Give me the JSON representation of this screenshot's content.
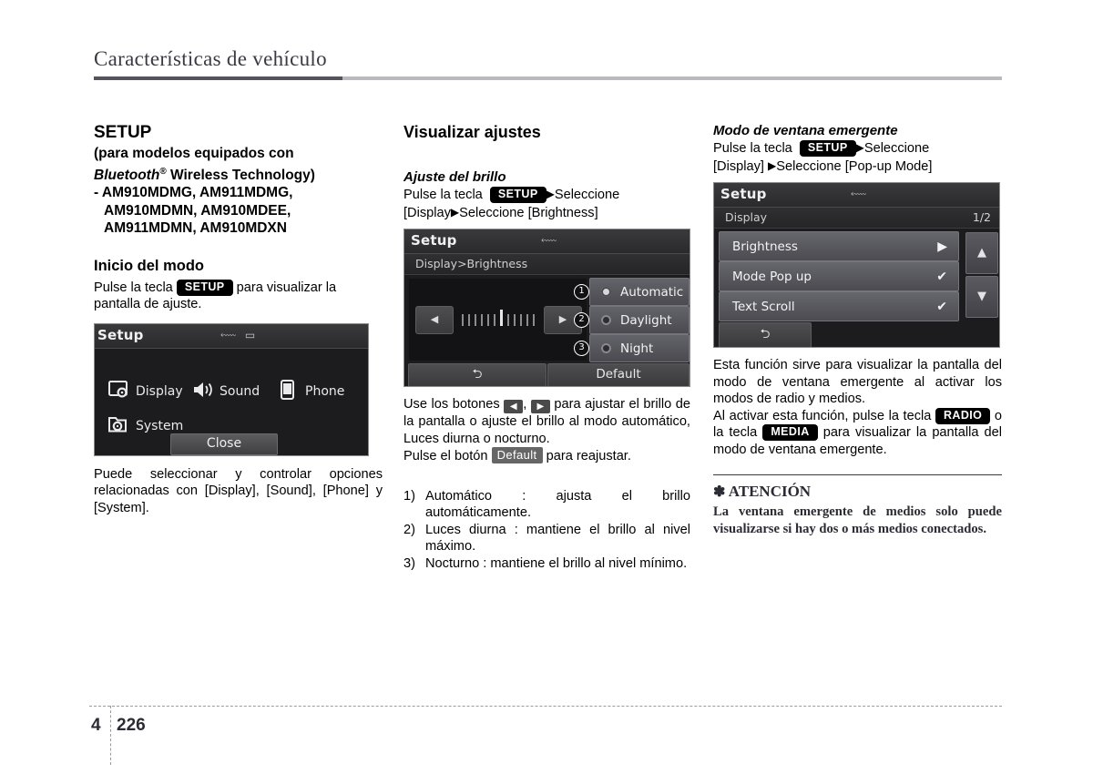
{
  "header": {
    "chapter_title": "Características de vehículo"
  },
  "footer": {
    "chapter_number": "4",
    "page_number": "226"
  },
  "left_column": {
    "heading": "SETUP",
    "subheading_line1": "(para modelos equipados con",
    "subheading_bluetooth": "Bluetooth",
    "subheading_reg": "®",
    "subheading_line2_rest": " Wireless Technology)",
    "model_line1": "- AM910MDMG, AM911MDMG,",
    "model_line2": "AM910MDMN, AM910MDEE,",
    "model_line3": "AM911MDMN, AM910MDXN",
    "section_heading": "Inicio del modo",
    "para_before_key": "Pulse la tecla",
    "key_setup": "SETUP",
    "para_after_key": "para visualizar la pantalla de ajuste.",
    "caption": "Puede seleccionar y controlar opciones relacionadas con [Display], [Sound], [Phone] y [System].",
    "device": {
      "title": "Setup",
      "icons": "⬳ ▭",
      "tiles": [
        {
          "label": "Display",
          "icon": "display-gear-icon"
        },
        {
          "label": "Sound",
          "icon": "speaker-icon"
        },
        {
          "label": "Phone",
          "icon": "phone-icon"
        },
        {
          "label": "System",
          "icon": "folder-gear-icon"
        }
      ],
      "close_label": "Close"
    }
  },
  "middle_column": {
    "heading": "Visualizar ajustes",
    "sub_italic": "Ajuste del brillo",
    "path_before_key": "Pulse  la  tecla",
    "key_setup": "SETUP",
    "path_after_key": "Seleccione",
    "path_line2a": "[Display",
    "path_line2b": "Seleccione [Brightness]",
    "device": {
      "title": "Setup",
      "icons": "⬳",
      "breadcrumb": "Display>Brightness",
      "options": [
        {
          "num": "1",
          "label": "Automatic",
          "selected": true
        },
        {
          "num": "2",
          "label": "Daylight",
          "selected": false
        },
        {
          "num": "3",
          "label": "Night",
          "selected": false
        }
      ],
      "back_icon": "back-arrow-icon",
      "default_label": "Default"
    },
    "para_use_1": "Use los botones",
    "para_use_sep": ",",
    "para_use_2": "para ajustar el brillo de la pantalla o ajuste el brillo al modo automático, Luces diurna o nocturno.",
    "para_default_1": "Pulse el botón",
    "key_default": "Default",
    "para_default_2": "para reajustar.",
    "numbered_items": [
      {
        "num": "1)",
        "text": "Automático  :  ajusta  el  brillo automáticamente."
      },
      {
        "num": "2)",
        "text": "Luces diurna : mantiene el brillo al nivel máximo."
      },
      {
        "num": "3)",
        "text": "Nocturno : mantiene el brillo al nivel mínimo."
      }
    ]
  },
  "right_column": {
    "sub_italic": "Modo de ventana emergente",
    "path_before_key": "Pulse   la   tecla",
    "key_setup": "SETUP",
    "path_after_key": "Seleccione",
    "path_line2": "[Display]",
    "path_line2b": "Seleccione [Pop-up Mode]",
    "device": {
      "title": "Setup",
      "icons": "⬳",
      "breadcrumb": "Display",
      "page_indicator": "1/2",
      "rows": [
        {
          "label": "Brightness",
          "mark": "▶"
        },
        {
          "label": "Mode Pop up",
          "mark": "✔"
        },
        {
          "label": "Text Scroll",
          "mark": "✔"
        }
      ],
      "scroll_up": "▲",
      "scroll_down": "▼",
      "back_icon": "back-arrow-icon"
    },
    "para1": "Esta función sirve para visualizar la pantalla del modo de ventana emergente al activar los modos de radio y medios.",
    "para2_a": "Al activar esta función, pulse la tecla",
    "key_radio": "RADIO",
    "para2_b": "o  la  tecla",
    "key_media": "MEDIA",
    "para2_c": "para visualizar la pantalla del modo de ventana emergente.",
    "caution_star": "✽",
    "caution_title": "ATENCIÓN",
    "caution_body": "La ventana emergente de medios solo puede visualizarse si hay dos o más medios conectados."
  },
  "colors": {
    "header_rule_dark": "#54545c",
    "header_rule_light": "#b9b9be",
    "key_badge_bg": "#000000",
    "default_badge_bg": "#666666",
    "device_bg": "#1c1c1e"
  }
}
